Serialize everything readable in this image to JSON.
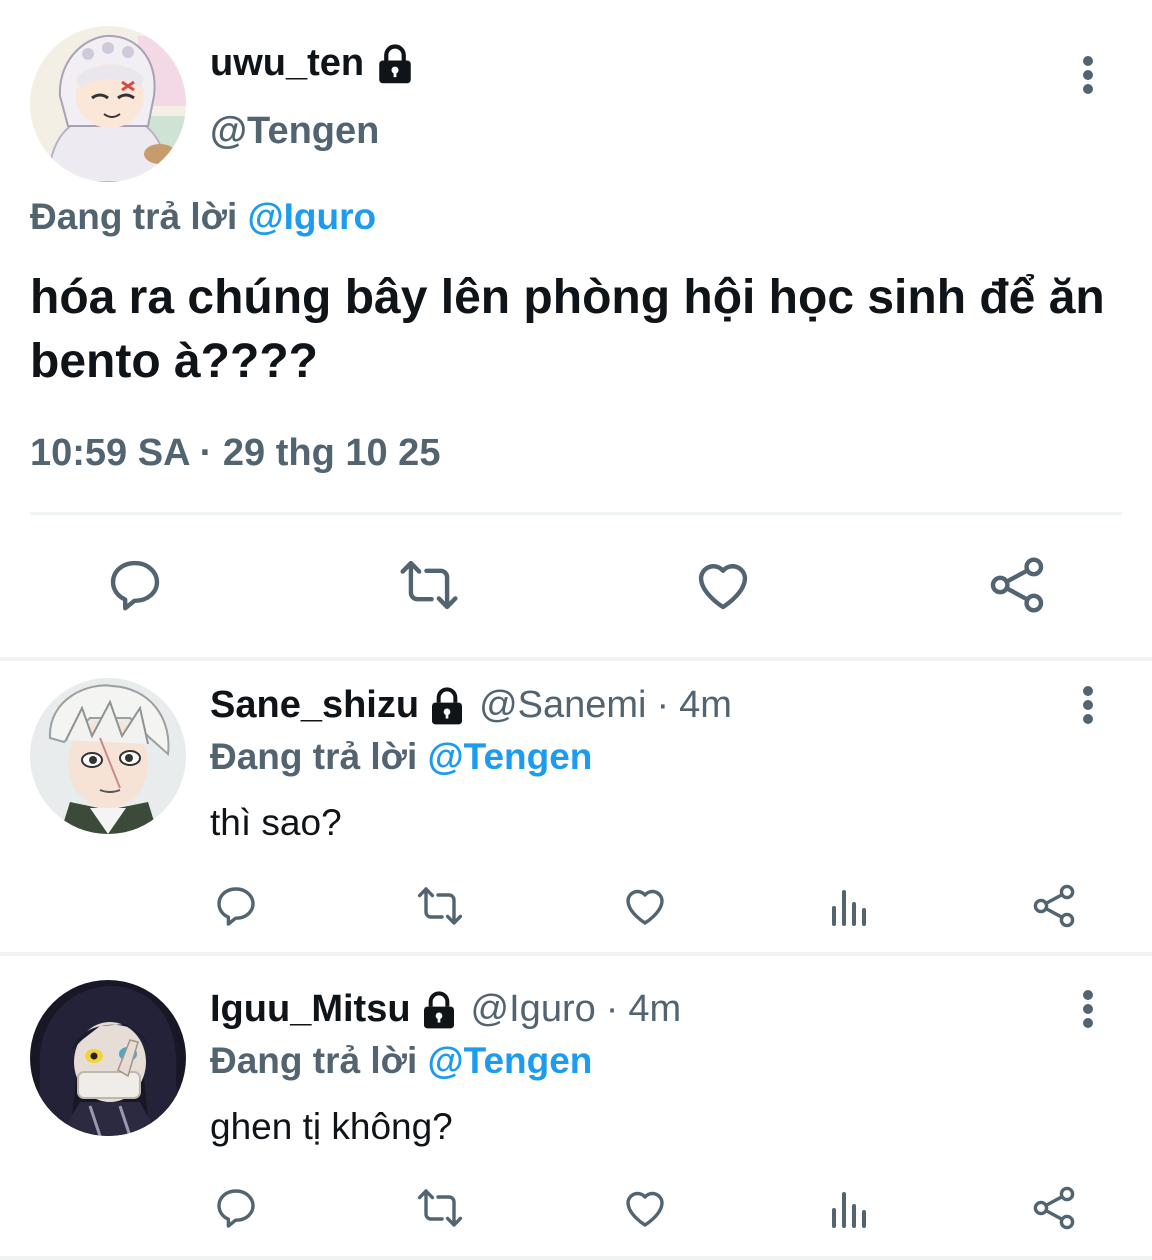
{
  "main_tweet": {
    "display_name": "uwu_ten",
    "handle": "@Tengen",
    "replying_prefix": "Đang trả lời",
    "replying_to": "@Iguro",
    "text": "hóa ra chúng bây lên phòng hội học sinh để ăn bento à????",
    "timestamp": "10:59 SA · 29 thg 10 25",
    "locked": true,
    "actions": [
      "reply-icon",
      "retweet-icon",
      "like-icon",
      "share-icon"
    ]
  },
  "replies": [
    {
      "display_name": "Sane_shizu",
      "handle": "@Sanemi",
      "separator": "·",
      "time": "4m",
      "replying_prefix": "Đang trả lời",
      "replying_to": "@Tengen",
      "text": "thì sao?",
      "locked": true,
      "actions": [
        "reply-icon",
        "retweet-icon",
        "like-icon",
        "views-icon",
        "share-icon"
      ]
    },
    {
      "display_name": "Iguu_Mitsu",
      "handle": "@Iguro",
      "separator": "·",
      "time": "4m",
      "replying_prefix": "Đang trả lời",
      "replying_to": "@Tengen",
      "text": "ghen tị không?",
      "locked": true,
      "actions": [
        "reply-icon",
        "retweet-icon",
        "like-icon",
        "views-icon",
        "share-icon"
      ]
    }
  ],
  "colors": {
    "text_primary": "#0f1419",
    "text_secondary": "#536471",
    "accent": "#1d9bf0",
    "divider": "#eff3f4",
    "icon": "#536471"
  }
}
